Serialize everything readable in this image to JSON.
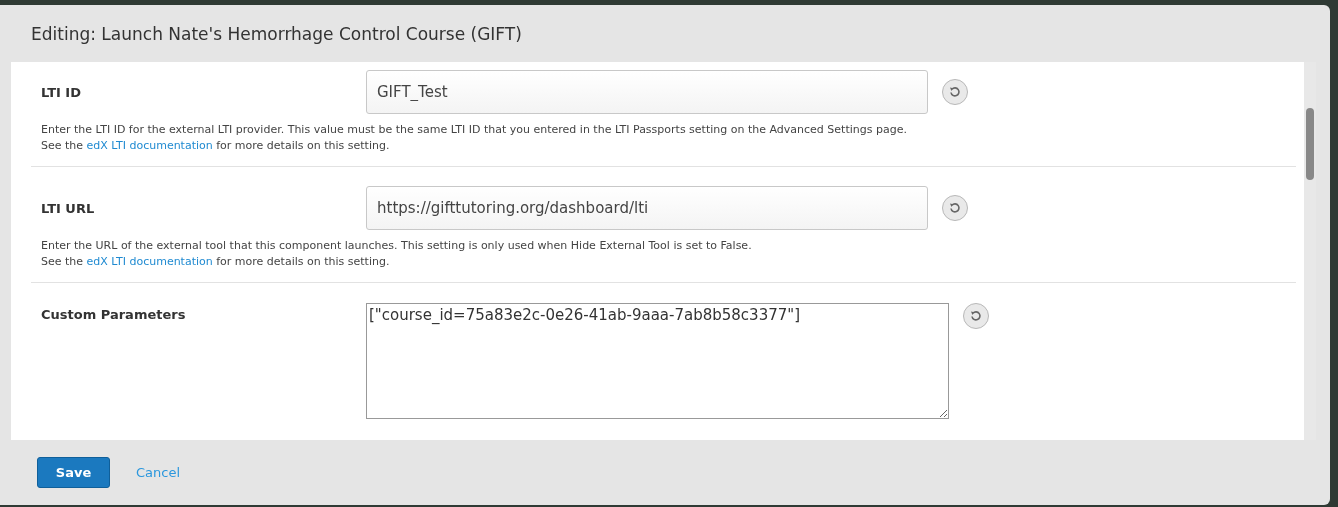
{
  "modal": {
    "title": "Editing: Launch Nate's Hemorrhage Control Course (GIFT)"
  },
  "settings": [
    {
      "kind": "input",
      "label": "LTI ID",
      "value": "GIFT_Test",
      "help": "Enter the LTI ID for the external LTI provider. This value must be the same LTI ID that you entered in the LTI Passports setting on the Advanced Settings page.",
      "see_before": "See the",
      "link": "edX LTI documentation",
      "see_after": "for more details on this setting."
    },
    {
      "kind": "input",
      "label": "LTI URL",
      "value": "https://gifttutoring.org/dashboard/lti",
      "help": "Enter the URL of the external tool that this component launches. This setting is only used when Hide External Tool is set to False.",
      "see_before": "See the",
      "link": "edX LTI documentation",
      "see_after": "for more details on this setting."
    },
    {
      "kind": "textarea",
      "label": "Custom Parameters",
      "value": "[\"course_id=75a83e2c-0e26-41ab-9aaa-7ab8b58c3377\"]"
    }
  ],
  "buttons": {
    "save": "Save",
    "cancel": "Cancel"
  }
}
